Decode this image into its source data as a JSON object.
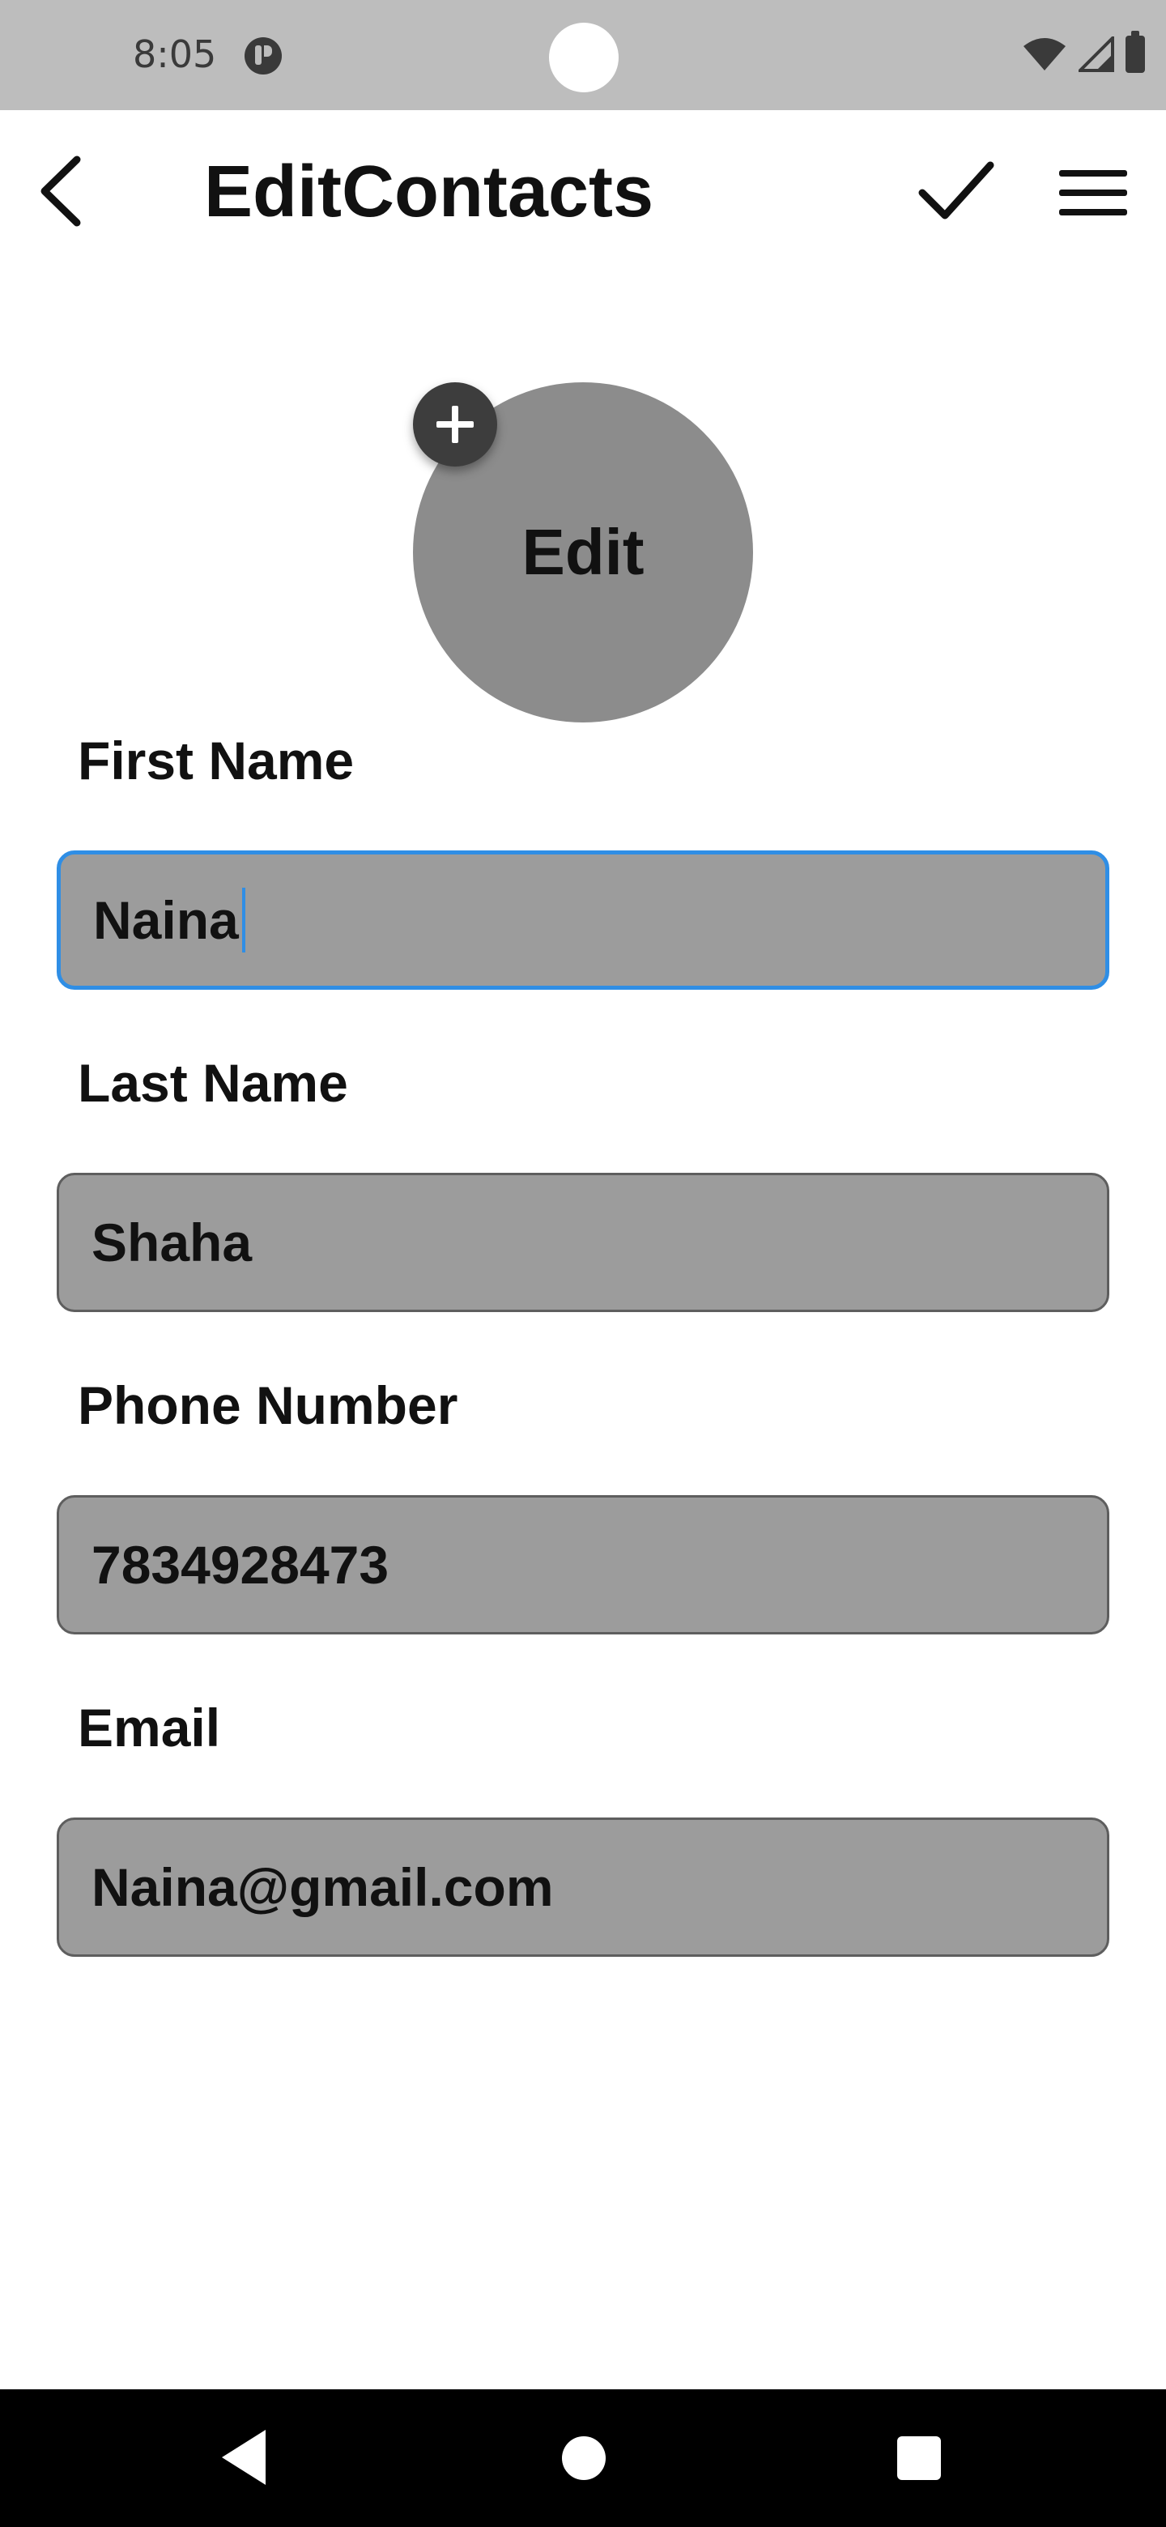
{
  "status_bar": {
    "time": "8:05",
    "icons": [
      "app-notification-icon",
      "wifi-icon",
      "signal-icon",
      "battery-icon"
    ]
  },
  "app_bar": {
    "title": "EditContacts",
    "back_icon": "chevron-left-icon",
    "save_icon": "check-icon",
    "menu_icon": "hamburger-menu-icon"
  },
  "avatar": {
    "label": "Edit",
    "add_icon": "plus-icon"
  },
  "form": {
    "fields": [
      {
        "label": "First Name",
        "value": "Naina",
        "focused": true
      },
      {
        "label": "Last Name",
        "value": "Shaha",
        "focused": false
      },
      {
        "label": "Phone Number",
        "value": "7834928473",
        "focused": false
      },
      {
        "label": "Email",
        "value": "Naina@gmail.com",
        "focused": false
      }
    ]
  },
  "colors": {
    "status_bar_bg": "#bdbdbd",
    "avatar_bg": "#8c8c8c",
    "input_bg": "#9c9c9c",
    "focus_accent": "#2f8ee5",
    "nav_bar_bg": "#000000"
  },
  "nav_bar": {
    "icons": [
      "nav-back-icon",
      "nav-home-icon",
      "nav-recents-icon"
    ]
  }
}
